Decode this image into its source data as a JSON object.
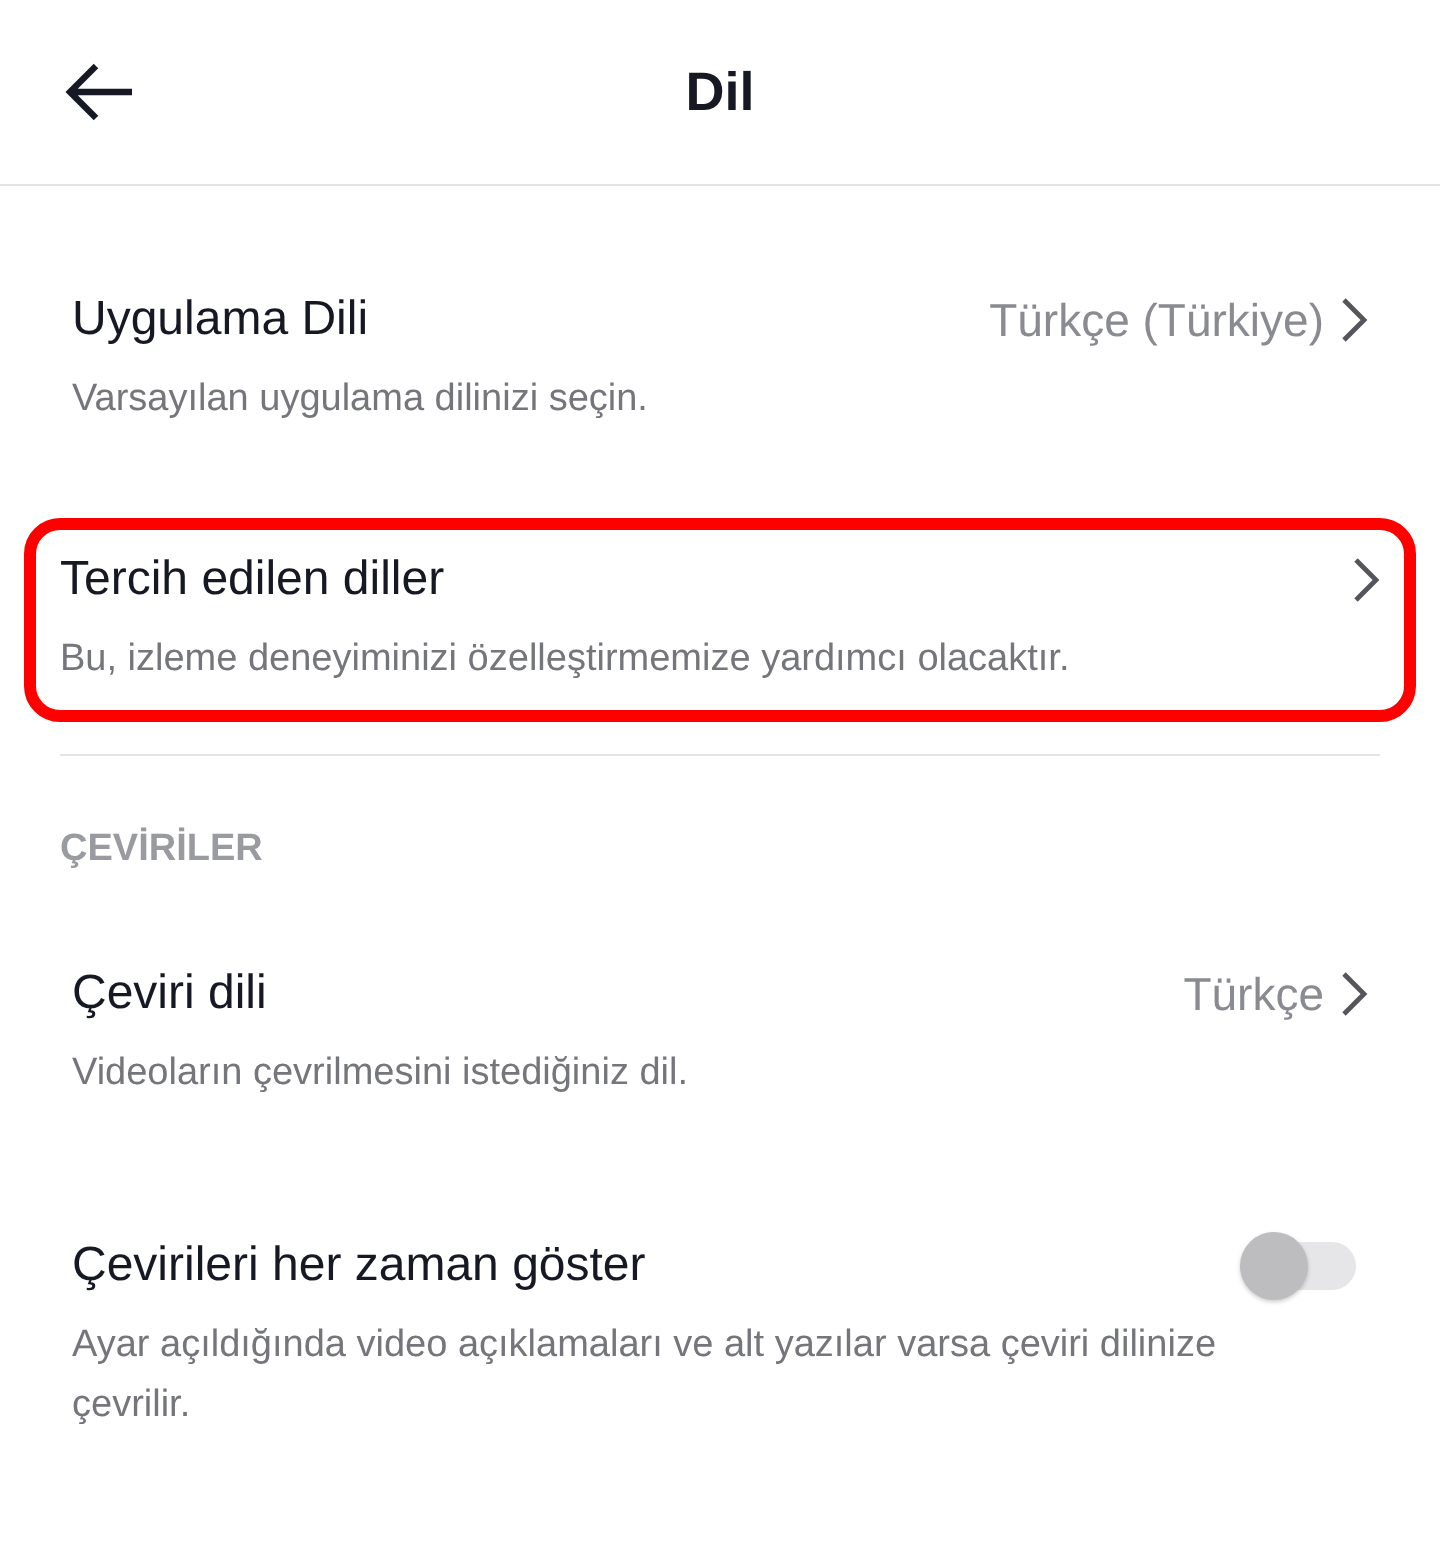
{
  "header": {
    "title": "Dil"
  },
  "items": [
    {
      "kind": "link",
      "title": "Uygulama Dili",
      "value": "Türkçe (Türkiye)",
      "description": "Varsayılan uygulama dilinizi seçin.",
      "highlighted": false
    },
    {
      "kind": "link",
      "title": "Tercih edilen diller",
      "description": "Bu, izleme deneyiminizi özelleştirmemize yardımcı olacaktır.",
      "highlighted": true
    }
  ],
  "section": {
    "title": "ÇEVİRİLER",
    "items": [
      {
        "kind": "link",
        "title": "Çeviri dili",
        "value": "Türkçe",
        "description": "Videoların çevrilmesini istediğiniz dil.",
        "highlighted": false
      },
      {
        "kind": "toggle",
        "title": "Çevirileri her zaman göster",
        "on": false,
        "description": "Ayar açıldığında video açıklamaları ve alt yazılar varsa çeviri dilinize çevrilir.",
        "highlighted": false
      }
    ]
  }
}
